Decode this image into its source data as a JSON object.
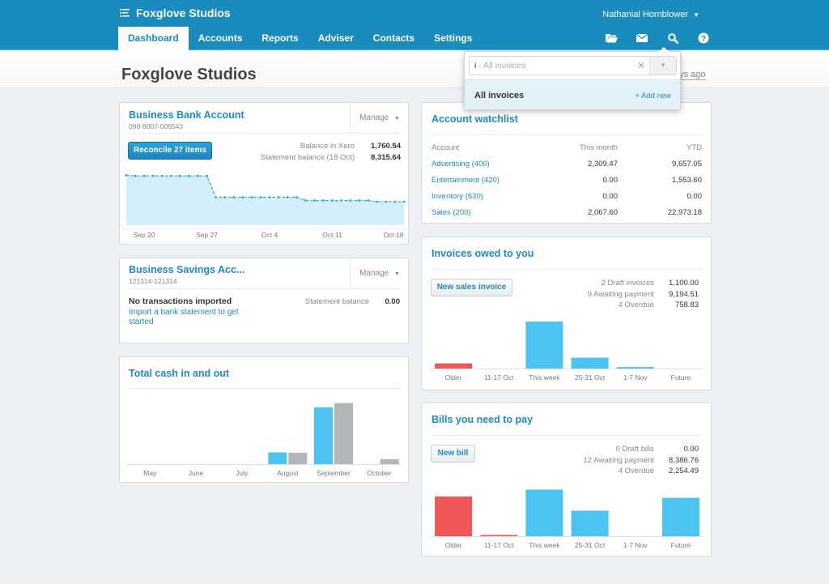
{
  "header": {
    "org_name": "Foxglove Studios",
    "org_icon": "menu-list-icon",
    "user_name": "Nathanial Hornblower",
    "tabs": [
      {
        "label": "Dashboard",
        "active": true
      },
      {
        "label": "Accounts",
        "active": false
      },
      {
        "label": "Reports",
        "active": false
      },
      {
        "label": "Adviser",
        "active": false
      },
      {
        "label": "Contacts",
        "active": false
      },
      {
        "label": "Settings",
        "active": false
      }
    ],
    "icons": [
      "folder-icon",
      "mail-icon",
      "search-icon",
      "help-icon"
    ]
  },
  "page": {
    "title": "Foxglove Studios",
    "last_updated_partial": "ays ago"
  },
  "search_popup": {
    "typed": "i",
    "hint": " - All invoices",
    "option_label": "All invoices",
    "add_new_label": "+ Add new"
  },
  "bank_account": {
    "title": "Business Bank Account",
    "number": "090-8007-006543",
    "manage_label": "Manage",
    "reconcile_label": "Reconcile 27 items",
    "balance_xero_label": "Balance in Xero",
    "balance_xero": "1,760.54",
    "statement_label": "Statement balance (18 Oct)",
    "statement_balance": "8,315.64",
    "colors": {
      "line": "#29a9e0",
      "fill": "#d3effa"
    }
  },
  "savings_account": {
    "title": "Business Savings Acc...",
    "number": "121314-121314",
    "manage_label": "Manage",
    "status": "No transactions imported",
    "import_link": "Import a bank statement to get started",
    "statement_label": "Statement balance",
    "statement_balance": "0.00"
  },
  "cash_chart_card": {
    "title": "Total cash in and out"
  },
  "watchlist": {
    "title": "Account watchlist",
    "columns": [
      "Account",
      "This month",
      "YTD"
    ],
    "rows": [
      [
        "Advertising (400)",
        "2,309.47",
        "9,657.05"
      ],
      [
        "Entertainment (420)",
        "0.00",
        "1,553.60"
      ],
      [
        "Inventory (630)",
        "0.00",
        "0.00"
      ],
      [
        "Sales (200)",
        "2,067.60",
        "22,973.18"
      ]
    ]
  },
  "invoices": {
    "title": "Invoices owed to you",
    "button_label": "New sales invoice",
    "summary": [
      {
        "label": "2 Draft invoices",
        "value": "1,100.00"
      },
      {
        "label": "9 Awaiting payment",
        "value": "9,194.51"
      },
      {
        "label": "4 Overdue",
        "value": "758.83"
      }
    ]
  },
  "bills": {
    "title": "Bills you need to pay",
    "button_label": "New bill",
    "summary": [
      {
        "label": "0 Draft bills",
        "value": "0.00"
      },
      {
        "label": "12 Awaiting payment",
        "value": "8,386.76"
      },
      {
        "label": "4 Overdue",
        "value": "2,254.49"
      }
    ]
  },
  "chart_data": [
    {
      "id": "bank_balance",
      "type": "area",
      "title": "",
      "x_tick_labels": [
        "Sep 20",
        "Sep 27",
        "Oct 4",
        "Oct 11",
        "Oct 18"
      ],
      "x_tick_index": [
        2,
        9,
        16,
        23,
        30
      ],
      "values": [
        8400,
        8300,
        8300,
        8300,
        8300,
        8300,
        8300,
        8300,
        8300,
        8300,
        4700,
        4700,
        4700,
        4700,
        4700,
        4700,
        4700,
        4700,
        4700,
        4700,
        4150,
        4150,
        4150,
        4150,
        4150,
        4150,
        4150,
        4150,
        3950,
        3950,
        3950,
        3950
      ],
      "ylim": [
        0,
        8600
      ],
      "grid": false
    },
    {
      "id": "cash_in_out",
      "type": "bar",
      "categories": [
        "May",
        "June",
        "July",
        "August",
        "September",
        "October"
      ],
      "series": [
        {
          "name": "Cash in",
          "color": "#4cc3f0",
          "values": [
            0,
            0,
            0,
            1900,
            9200,
            0
          ]
        },
        {
          "name": "Cash out",
          "color": "#b3b6b9",
          "values": [
            0,
            0,
            0,
            1850,
            9900,
            800
          ]
        }
      ],
      "ylim": [
        0,
        10500
      ],
      "grid": false
    },
    {
      "id": "invoices_owed",
      "type": "bar",
      "categories": [
        "Older",
        "11-17 Oct",
        "This week",
        "25-31 Oct",
        "1-7 Nov",
        "Future"
      ],
      "values": [
        758.83,
        0,
        6900,
        1600,
        220,
        0
      ],
      "colors": [
        "#f05656",
        "#4cc3f0",
        "#4cc3f0",
        "#4cc3f0",
        "#4cc3f0",
        "#4cc3f0"
      ],
      "ylim": [
        0,
        7500
      ],
      "grid": false
    },
    {
      "id": "bills_to_pay",
      "type": "bar",
      "categories": [
        "Older",
        "11-17 Oct",
        "This week",
        "25-31 Oct",
        "1-7 Nov",
        "Future"
      ],
      "values": [
        2254.49,
        40,
        2650,
        1450,
        0,
        2180
      ],
      "colors": [
        "#f05656",
        "#f05656",
        "#4cc3f0",
        "#4cc3f0",
        "#4cc3f0",
        "#4cc3f0"
      ],
      "ylim": [
        0,
        2900
      ],
      "grid": false
    }
  ]
}
